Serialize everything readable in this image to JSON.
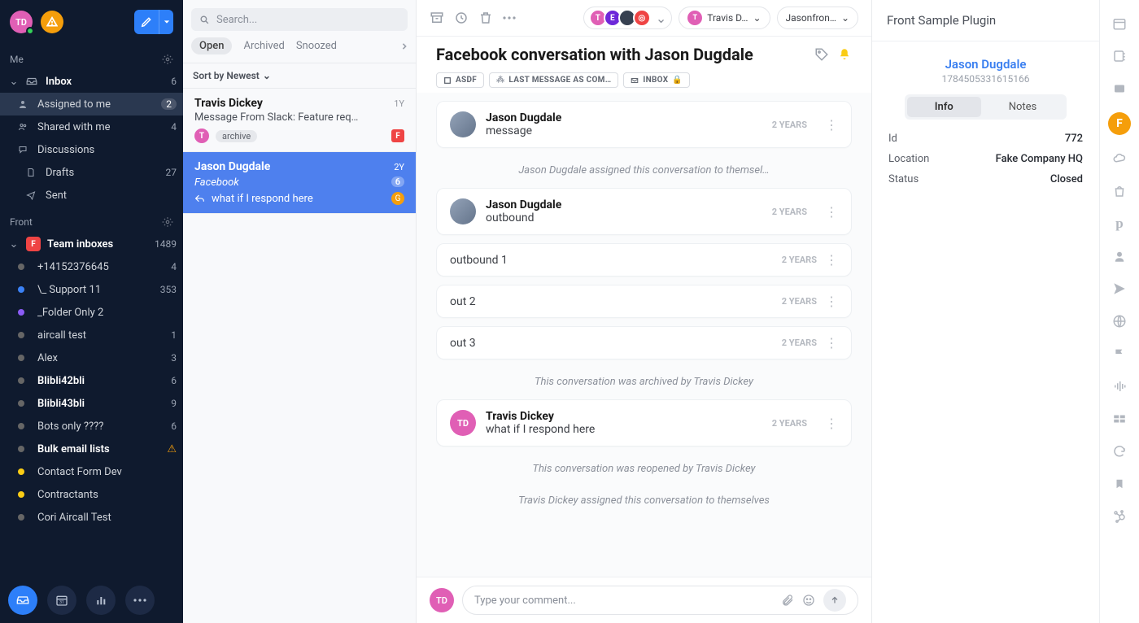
{
  "header": {
    "avatar_initials": "TD",
    "compose_tooltip": "Compose"
  },
  "nav": {
    "me_label": "Me",
    "inbox": {
      "label": "Inbox",
      "count": "6"
    },
    "assigned": {
      "label": "Assigned to me",
      "count": "2"
    },
    "shared": {
      "label": "Shared with me",
      "count": "4"
    },
    "discussions": {
      "label": "Discussions"
    },
    "drafts": {
      "label": "Drafts",
      "count": "27"
    },
    "sent": {
      "label": "Sent"
    },
    "front_label": "Front",
    "team_inboxes": {
      "label": "Team inboxes",
      "count": "1489"
    },
    "items": [
      {
        "label": "+14152376645",
        "count": "4",
        "dot": ""
      },
      {
        "label": "\\_ Support 11",
        "count": "353",
        "dot": "blue"
      },
      {
        "label": "_Folder Only 2",
        "dot": "purple"
      },
      {
        "label": "aircall test",
        "count": "1",
        "dot": ""
      },
      {
        "label": "Alex",
        "count": "3",
        "dot": ""
      },
      {
        "label": "Blibli42bli",
        "count": "6",
        "dot": "",
        "bold": true
      },
      {
        "label": "Blibli43bli",
        "count": "9",
        "dot": "",
        "bold": true
      },
      {
        "label": "Bots only ????",
        "count": "6",
        "dot": ""
      },
      {
        "label": "Bulk email lists",
        "warn": true,
        "dot": "",
        "bold": true
      },
      {
        "label": "Contact Form Dev",
        "dot": "yellow"
      },
      {
        "label": "Contractants",
        "dot": "yellow"
      },
      {
        "label": "Cori Aircall Test",
        "dot": ""
      }
    ]
  },
  "list": {
    "search_placeholder": "Search...",
    "tabs": {
      "open": "Open",
      "archived": "Archived",
      "snoozed": "Snoozed"
    },
    "sort_label": "Sort by Newest",
    "convs": [
      {
        "name": "Travis Dickey",
        "time": "1Y",
        "subject": "Message From Slack: Feature req…",
        "tag": "archive",
        "avatar_letter": "T",
        "avatar_color": "#e05fb5",
        "badge_letter": "F"
      },
      {
        "name": "Jason Dugdale",
        "time": "2Y",
        "subject": "Facebook",
        "reply_line": "what if I respond here",
        "count": "6",
        "badge_letter": "G"
      }
    ]
  },
  "conversation": {
    "title": "Facebook conversation with Jason Dugdale",
    "assign_label": "Travis D…",
    "link_label": "Jasonfron…",
    "chips": [
      "ASDF",
      "LAST MESSAGE AS COM…",
      "INBOX"
    ],
    "messages": [
      {
        "author": "Jason Dugdale",
        "body": "message",
        "time": "2 YEARS",
        "avatar": "photo1"
      },
      {
        "event": "Jason Dugdale assigned this conversation to themsel…"
      },
      {
        "author": "Jason Dugdale",
        "body": "outbound",
        "time": "2 YEARS",
        "avatar": "photo2"
      },
      {
        "slim": true,
        "body": "outbound 1",
        "time": "2 YEARS"
      },
      {
        "slim": true,
        "body": "out 2",
        "time": "2 YEARS"
      },
      {
        "slim": true,
        "body": "out 3",
        "time": "2 YEARS"
      },
      {
        "event": "This conversation was archived by Travis Dickey"
      },
      {
        "author": "Travis Dickey",
        "body": "what if I respond here",
        "time": "2 YEARS",
        "avatar": "TD",
        "avatar_color": "#e05fb5"
      },
      {
        "event": "This conversation was reopened by Travis Dickey"
      },
      {
        "event": "Travis Dickey assigned this conversation to themselves"
      }
    ],
    "composer_placeholder": "Type your comment...",
    "composer_avatar": "TD"
  },
  "plugin": {
    "title": "Front Sample Plugin",
    "contact_name": "Jason Dugdale",
    "contact_id": "1784505331615166",
    "tabs": {
      "info": "Info",
      "notes": "Notes"
    },
    "fields": [
      {
        "k": "Id",
        "v": "772"
      },
      {
        "k": "Location",
        "v": "Fake Company HQ"
      },
      {
        "k": "Status",
        "v": "Closed"
      }
    ],
    "rail_badge": "F"
  }
}
